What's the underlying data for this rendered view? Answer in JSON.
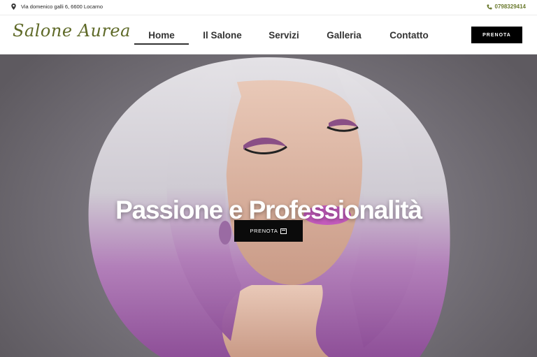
{
  "topbar": {
    "address": "Via domenico galli 6, 6600 Locarno",
    "phone": "0798329414",
    "address_icon": "map-pin-icon",
    "phone_icon": "phone-icon"
  },
  "brand": {
    "logo_text": "Salone Aurea",
    "accent_color": "#6b7a2e"
  },
  "nav": {
    "items": [
      {
        "label": "Home",
        "active": true
      },
      {
        "label": "Il Salone",
        "active": false
      },
      {
        "label": "Servizi",
        "active": false
      },
      {
        "label": "Galleria",
        "active": false
      },
      {
        "label": "Contatto",
        "active": false
      }
    ],
    "cta_label": "PRENOTA"
  },
  "hero": {
    "title": "Passione e Professionalità",
    "button_label": "PRENOTA",
    "button_icon": "calendar-icon",
    "image": "woman-with-silver-and-pink-ombre-bob-hair"
  }
}
